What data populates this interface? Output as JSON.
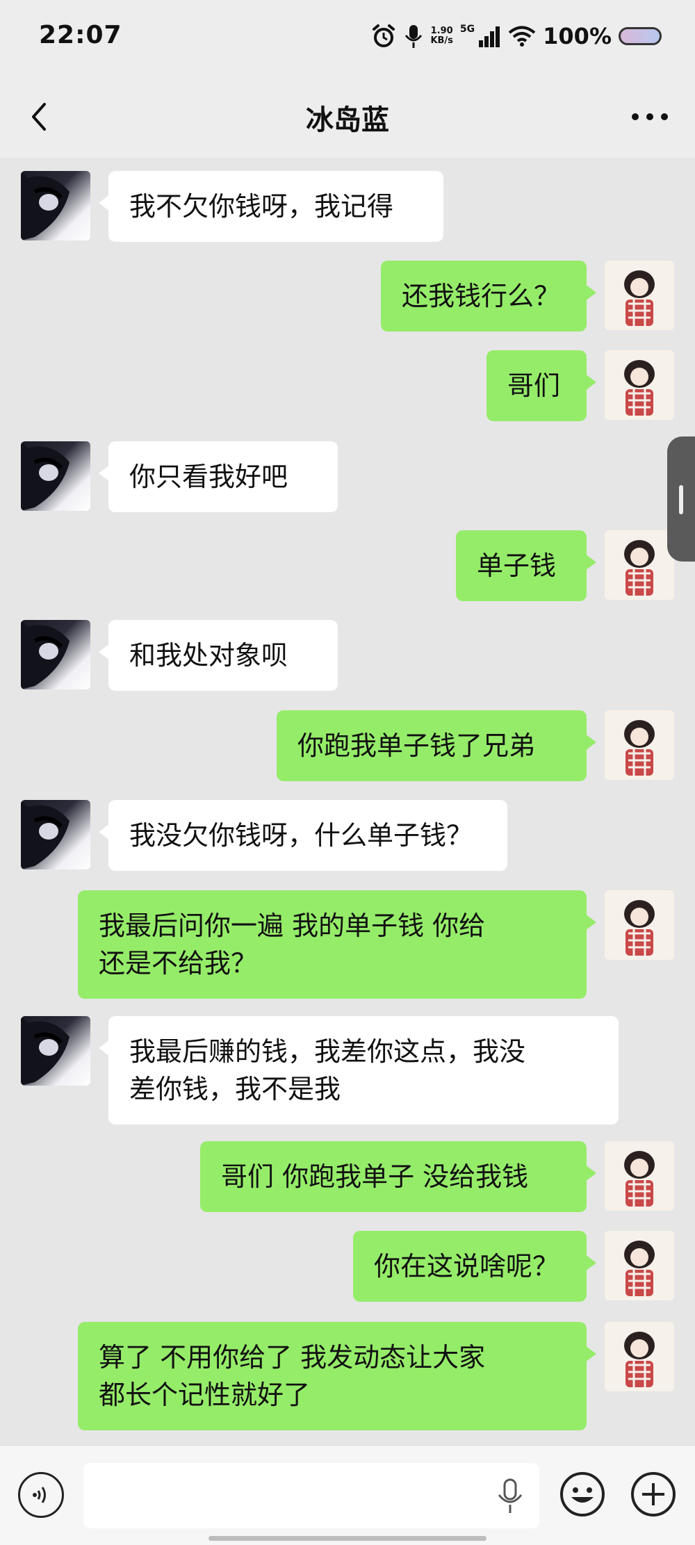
{
  "status_bar": {
    "time": "22:07",
    "net_speed_value": "1.90",
    "net_speed_unit": "KB/s",
    "network": "5G",
    "battery_percent": "100%"
  },
  "header": {
    "title": "冰岛蓝"
  },
  "messages": [
    {
      "side": "left",
      "text": "我不欠你钱呀，我记得"
    },
    {
      "side": "right",
      "text": "还我钱行么？"
    },
    {
      "side": "right",
      "text": "哥们"
    },
    {
      "side": "left",
      "text": "你只看我好吧"
    },
    {
      "side": "right",
      "text": "单子钱"
    },
    {
      "side": "left",
      "text": "和我处对象呗"
    },
    {
      "side": "right",
      "text": "你跑我单子钱了兄弟"
    },
    {
      "side": "left",
      "text": "我没欠你钱呀，什么单子钱？"
    },
    {
      "side": "right",
      "text": "我最后问你一遍 我的单子钱 你给\n还是不给我？"
    },
    {
      "side": "left",
      "text": "我最后赚的钱，我差你这点，我没\n差你钱，我不是我"
    },
    {
      "side": "right",
      "text": "哥们 你跑我单子 没给我钱"
    },
    {
      "side": "right",
      "text": "你在这说啥呢？"
    },
    {
      "side": "right",
      "text": "算了 不用你给了 我发动态让大家\n都长个记性就好了"
    }
  ],
  "input": {
    "value": "",
    "placeholder": ""
  },
  "icons": {
    "back": "chevron-left-icon",
    "more": "more-dots-icon",
    "voice": "voice-input-icon",
    "mic": "microphone-icon",
    "emoji": "emoji-icon",
    "plus": "plus-icon"
  }
}
